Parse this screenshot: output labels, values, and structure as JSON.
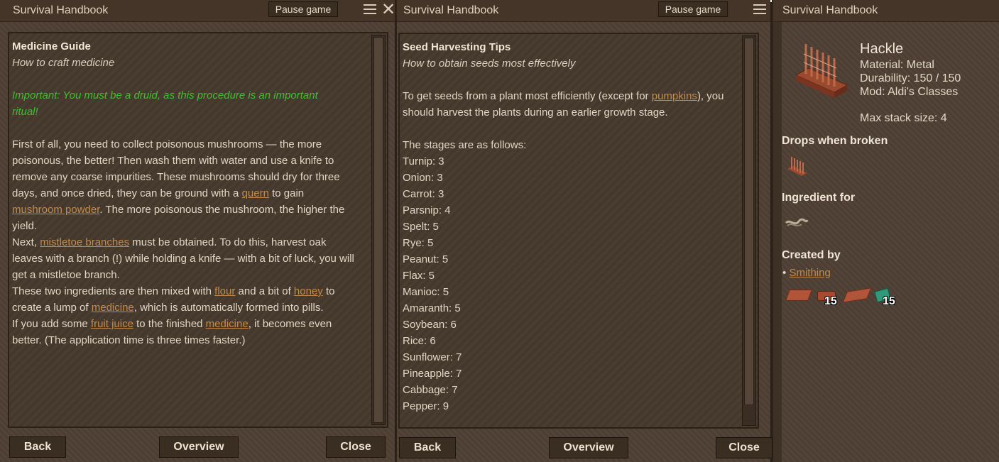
{
  "panel1": {
    "title": "Survival Handbook",
    "pause": "Pause game",
    "heading": "Medicine Guide",
    "subtitle": "How to craft medicine",
    "important_1": "Important: You must be a druid, as this procedure is an important",
    "important_2": "ritual!",
    "p1_l1": "First of all, you need to collect poisonous mushrooms — the more",
    "p1_l2": "poisonous, the better! Then wash them with water and use a knife to",
    "p1_l3": "remove any coarse impurities. These mushrooms should dry for three",
    "p1_l4a": "days, and once dried, they can be ground with a ",
    "link_quern": "quern",
    "p1_l4b": " to gain",
    "link_mushroom_powder": "mushroom powder",
    "p1_l5b": ". The more poisonous the mushroom, the higher the",
    "p1_l6": "yield.",
    "p2_l1a": "Next, ",
    "link_mistletoe": "mistletoe branches",
    "p2_l1b": " must be obtained. To do this, harvest oak",
    "p2_l2": "leaves with a branch (!) while holding a knife — with a bit of luck, you will",
    "p2_l3": "get a mistletoe branch.",
    "p3_l1a": "These two ingredients are then mixed with ",
    "link_flour": "flour",
    "p3_l1b": " and a bit of ",
    "link_honey": "honey",
    "p3_l1c": " to",
    "p3_l2a": "create a lump of ",
    "link_medicine": "medicine",
    "p3_l2b": ", which is automatically formed into pills.",
    "p4_l1a": "If you add some ",
    "link_fruit_juice": "fruit juice",
    "p4_l1b": " to the finished ",
    "link_medicine2": "medicine",
    "p4_l1c": ", it becomes even",
    "p4_l2": "better. (The application time is three times faster.)",
    "back": "Back",
    "overview": "Overview",
    "close": "Close"
  },
  "panel2": {
    "title": "Survival Handbook",
    "pause": "Pause game",
    "heading": "Seed Harvesting Tips",
    "subtitle": "How to obtain seeds most effectively",
    "intro_l1a": "To get seeds from a plant most efficiently (except for ",
    "link_pumpkins": "pumpkins",
    "intro_l1b": "), you",
    "intro_l2": "should harvest the plants during an earlier growth stage.",
    "stages_intro": "The stages are as follows:",
    "stages": [
      "Turnip: 3",
      "Onion: 3",
      "Carrot: 3",
      "Parsnip: 4",
      "Spelt: 5",
      "Rye: 5",
      "Peanut: 5",
      "Flax: 5",
      "Manioc: 5",
      "Amaranth: 5",
      "Soybean: 6",
      "Rice: 6",
      "Sunflower: 7",
      "Pineapple: 7",
      "Cabbage: 7",
      "Pepper: 9"
    ],
    "back": "Back",
    "overview": "Overview",
    "close": "Close"
  },
  "panel3": {
    "title": "Survival Handbook",
    "item_name": "Hackle",
    "material": "Material: Metal",
    "durability": "Durability: 150 / 150",
    "mod": "Mod: Aldi's Classes",
    "max_stack": "Max stack size: 4",
    "drops_heading": "Drops when broken",
    "ingredient_heading": "Ingredient for",
    "created_heading": "Created by",
    "bullet": "•",
    "link_smithing": "Smithing",
    "count_1": "15",
    "count_2": "15"
  },
  "colors": {
    "link": "#c38a4a",
    "important": "#3fbf2f",
    "panel_bg": "#4f4034"
  }
}
